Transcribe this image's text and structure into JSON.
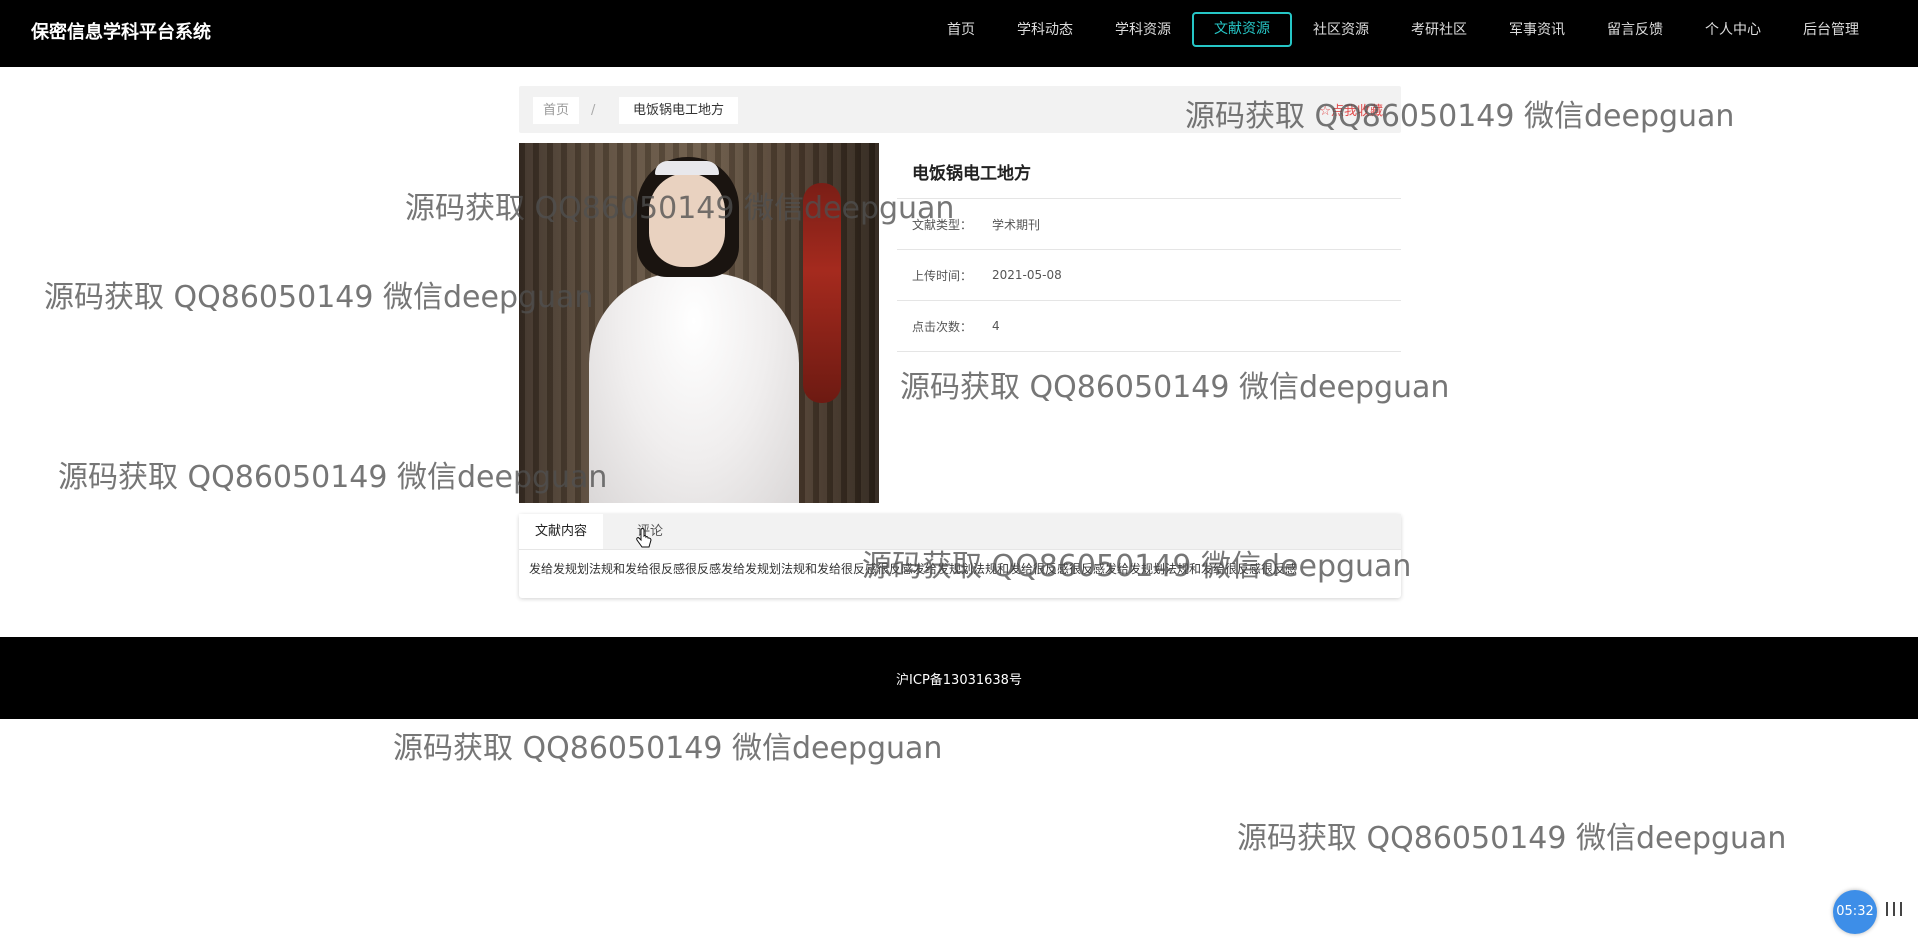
{
  "header": {
    "brand": "保密信息学科平台系统",
    "nav": [
      "首页",
      "学科动态",
      "学科资源",
      "文献资源",
      "社区资源",
      "考研社区",
      "军事资讯",
      "留言反馈",
      "个人中心",
      "后台管理"
    ],
    "active_nav": "文献资源"
  },
  "breadcrumb": {
    "home": "首页",
    "separator": "/",
    "current": "电饭锅电工地方",
    "favorite": "☆点我收藏"
  },
  "detail": {
    "title": "电饭锅电工地方",
    "rows": [
      {
        "label": "文献类型：",
        "value": "学术期刊"
      },
      {
        "label": "上传时间：",
        "value": "2021-05-08"
      },
      {
        "label": "点击次数：",
        "value": "4"
      }
    ]
  },
  "tabs": {
    "items": [
      "文献内容",
      "评论"
    ],
    "content": "发给发规划法规和发给很反感很反感发给发规划法规和发给很反感很反感发给发规划法规和发给很反感很反感发给发规划法规和发给很反感很反感"
  },
  "footer": {
    "icp": "沪ICP备13031638号"
  },
  "watermark": "源码获取 QQ86050149 微信deepguan",
  "timer": {
    "time": "05:32"
  },
  "colors": {
    "accent": "#26c6c6",
    "favorite": "#e04b4b",
    "header_bg": "#000000"
  }
}
